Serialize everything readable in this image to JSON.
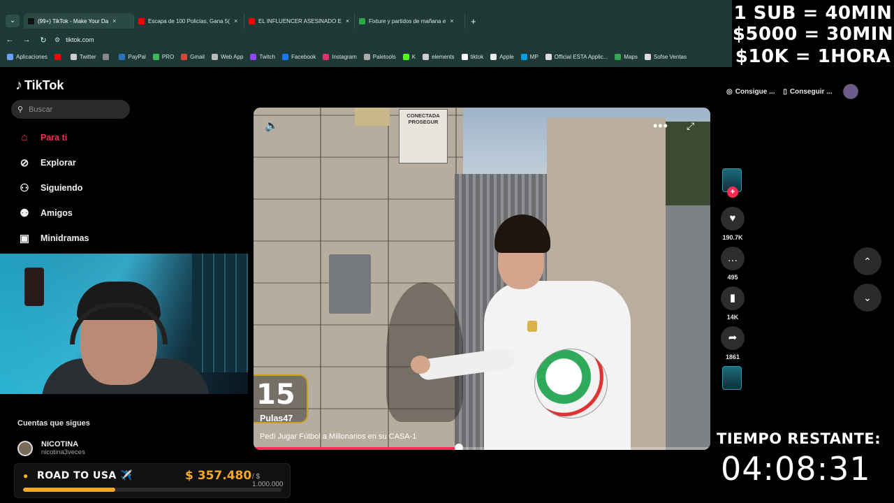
{
  "browser": {
    "tabs": [
      {
        "title": "(99+) TikTok - Make Your Da",
        "favicon_color": "#111111",
        "active": true
      },
      {
        "title": "Escapa de 100 Policías, Gana 5(",
        "favicon_color": "#ff0000",
        "active": false
      },
      {
        "title": "EL INFLUENCER ASESINADO E",
        "favicon_color": "#ff0000",
        "active": false
      },
      {
        "title": "Fixture y partidos de mañana e",
        "favicon_color": "#2aa84a",
        "active": false
      }
    ],
    "new_tab": "+",
    "url": "tiktok.com",
    "bookmarks": [
      {
        "label": "Aplicaciones",
        "color": "#6aa0ff"
      },
      {
        "label": "",
        "color": "#ff0000"
      },
      {
        "label": "Twitter",
        "color": "#cccccc"
      },
      {
        "label": "",
        "color": "#888888"
      },
      {
        "label": "PayPal",
        "color": "#2c6fbb"
      },
      {
        "label": "PRO",
        "color": "#3dbb5a"
      },
      {
        "label": "Gmail",
        "color": "#d44638"
      },
      {
        "label": "Web App",
        "color": "#bbbbbb"
      },
      {
        "label": "Twitch",
        "color": "#9146ff"
      },
      {
        "label": "Facebook",
        "color": "#1877f2"
      },
      {
        "label": "Instagram",
        "color": "#e1306c"
      },
      {
        "label": "Paletools",
        "color": "#aaaaaa"
      },
      {
        "label": "K",
        "color": "#53fc18"
      },
      {
        "label": "elements",
        "color": "#cccccc"
      },
      {
        "label": "tiktok",
        "color": "#ffffff"
      },
      {
        "label": "Apple",
        "color": "#eeeeee"
      },
      {
        "label": "MP",
        "color": "#00a0e3"
      },
      {
        "label": "Official ESTA Applic...",
        "color": "#dddddd"
      },
      {
        "label": "Maps",
        "color": "#34a853"
      },
      {
        "label": "Sofse Ventas",
        "color": "#dddddd"
      }
    ]
  },
  "promo": {
    "line1": "1 SUB = 40MIN",
    "line2": "$5000 = 30MIN",
    "line3": "$10K = 1HORA"
  },
  "tiktok": {
    "logo": "TikTok",
    "search_placeholder": "Buscar",
    "nav": [
      {
        "label": "Para ti",
        "icon": "home-icon"
      },
      {
        "label": "Explorar",
        "icon": "compass-icon"
      },
      {
        "label": "Siguiendo",
        "icon": "user-plus-icon"
      },
      {
        "label": "Amigos",
        "icon": "friends-icon"
      },
      {
        "label": "Minidramas",
        "icon": "film-icon"
      }
    ],
    "following_title": "Cuentas que sigues",
    "following": [
      {
        "name": "NICOTINA",
        "handle": "nicotina3veces"
      }
    ],
    "header_buttons": {
      "coins": "Consigue ...",
      "app": "Conseguir ..."
    }
  },
  "video": {
    "rank": "15",
    "username": "Pulas47",
    "caption": "Pedí Jugar Fútbol a Millonarios en su CASA-1",
    "sign_text": "CONECTADA\nPROSEGUR",
    "progress": 0.45,
    "likes": "190.7K",
    "comments": "495",
    "saves": "14K",
    "shares": "1861"
  },
  "goal": {
    "name": "ROAD TO USA ✈️",
    "current": "$ 357.480",
    "target": "/ $ 1.000.000",
    "fraction": 0.357
  },
  "timer": {
    "label": "TIEMPO RESTANTE:",
    "value": "04:08:31"
  }
}
